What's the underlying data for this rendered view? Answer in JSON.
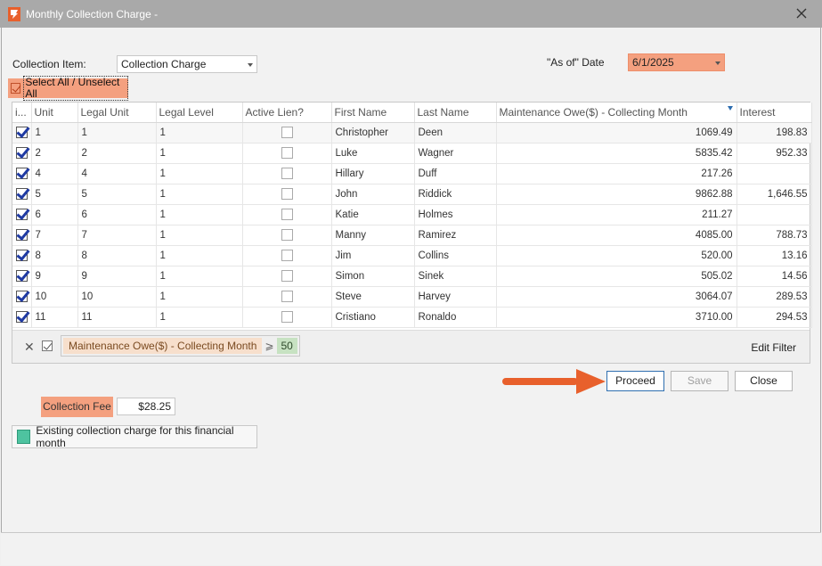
{
  "window": {
    "title": "Monthly Collection Charge -"
  },
  "form": {
    "collection_item_label": "Collection Item:",
    "collection_item_value": "Collection Charge",
    "as_of_label": "\"As of\" Date",
    "as_of_value": "6/1/2025",
    "select_all_label": "Select All / Unselect All"
  },
  "grid": {
    "columns": [
      "i...",
      "Unit",
      "Legal Unit",
      "Legal Level",
      "Active Lien?",
      "First Name",
      "Last Name",
      "Maintenance Owe($) - Collecting Month",
      "Interest"
    ],
    "rows": [
      {
        "unit": "1",
        "legal_unit": "1",
        "legal_level": "1",
        "first": "Christopher",
        "last": "Deen",
        "owe": "1069.49",
        "interest": "198.83"
      },
      {
        "unit": "2",
        "legal_unit": "2",
        "legal_level": "1",
        "first": "Luke",
        "last": "Wagner",
        "owe": "5835.42",
        "interest": "952.33"
      },
      {
        "unit": "4",
        "legal_unit": "4",
        "legal_level": "1",
        "first": "Hillary",
        "last": "Duff",
        "owe": "217.26",
        "interest": ""
      },
      {
        "unit": "5",
        "legal_unit": "5",
        "legal_level": "1",
        "first": "John",
        "last": "Riddick",
        "owe": "9862.88",
        "interest": "1,646.55"
      },
      {
        "unit": "6",
        "legal_unit": "6",
        "legal_level": "1",
        "first": "Katie",
        "last": "Holmes",
        "owe": "211.27",
        "interest": ""
      },
      {
        "unit": "7",
        "legal_unit": "7",
        "legal_level": "1",
        "first": "Manny",
        "last": "Ramirez",
        "owe": "4085.00",
        "interest": "788.73"
      },
      {
        "unit": "8",
        "legal_unit": "8",
        "legal_level": "1",
        "first": "Jim",
        "last": "Collins",
        "owe": "520.00",
        "interest": "13.16"
      },
      {
        "unit": "9",
        "legal_unit": "9",
        "legal_level": "1",
        "first": "Simon",
        "last": "Sinek",
        "owe": "505.02",
        "interest": "14.56"
      },
      {
        "unit": "10",
        "legal_unit": "10",
        "legal_level": "1",
        "first": "Steve",
        "last": "Harvey",
        "owe": "3064.07",
        "interest": "289.53"
      },
      {
        "unit": "11",
        "legal_unit": "11",
        "legal_level": "1",
        "first": "Cristiano",
        "last": "Ronaldo",
        "owe": "3710.00",
        "interest": "294.53"
      }
    ]
  },
  "filter": {
    "field": "Maintenance Owe($) - Collecting Month",
    "operator": "⩾",
    "value": "50",
    "edit_label": "Edit Filter"
  },
  "buttons": {
    "proceed": "Proceed",
    "save": "Save",
    "close": "Close"
  },
  "fee": {
    "label": "Collection Fee",
    "value": "$28.25"
  },
  "legend": {
    "text": "Existing collection charge for this financial month",
    "color": "#4ec3a0"
  },
  "colors": {
    "highlight": "#f4a07f",
    "arrow": "#e8602c",
    "titlebar": "#a9a9a9"
  }
}
